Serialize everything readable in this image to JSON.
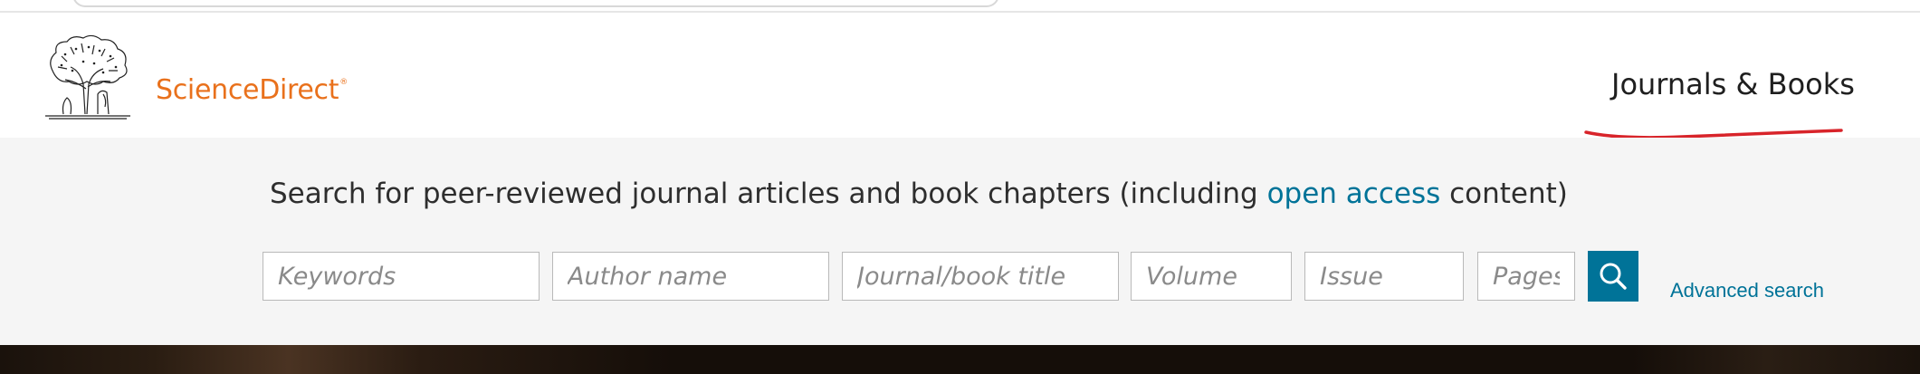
{
  "header": {
    "brand": "ScienceDirect",
    "brand_mark": "®",
    "nav_link": "Journals & Books"
  },
  "search": {
    "tagline_before": "Search for peer-reviewed journal articles and book chapters (including ",
    "tagline_link": "open access",
    "tagline_after": " content)",
    "fields": {
      "keywords": "Keywords",
      "author": "Author name",
      "journal": "Journal/book title",
      "volume": "Volume",
      "issue": "Issue",
      "pages": "Pages"
    },
    "advanced": "Advanced search"
  },
  "colors": {
    "brand": "#e9711c",
    "accent": "#007398",
    "annotation": "#d8242a"
  },
  "icons": {
    "logo": "elsevier-tree-icon",
    "search": "search-icon"
  }
}
